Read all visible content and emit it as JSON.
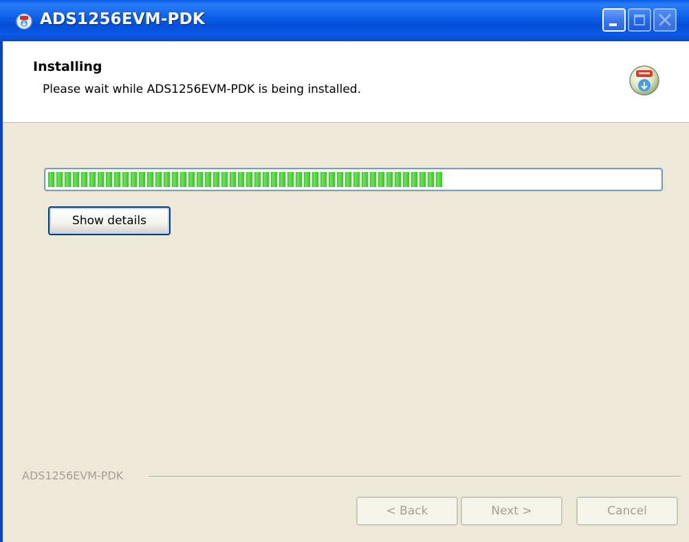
{
  "window": {
    "title": "ADS1256EVM-PDK",
    "controls": [
      "minimize",
      "maximize",
      "close"
    ]
  },
  "header": {
    "title": "Installing",
    "subtitle": "Please wait while ADS1256EVM-PDK is being installed."
  },
  "progress": {
    "value_percent": 65
  },
  "buttons": {
    "show_details": "Show details",
    "back": "< Back",
    "next": "Next >",
    "cancel": "Cancel"
  },
  "footer": {
    "brand": "ADS1256EVM-PDK"
  },
  "colors": {
    "titlebar": "#0a5be8",
    "progress_fill": "#37c323",
    "dialog_bg": "#ece9d8"
  },
  "icons": {
    "title": "installer-icon",
    "header": "install-disc-icon"
  }
}
